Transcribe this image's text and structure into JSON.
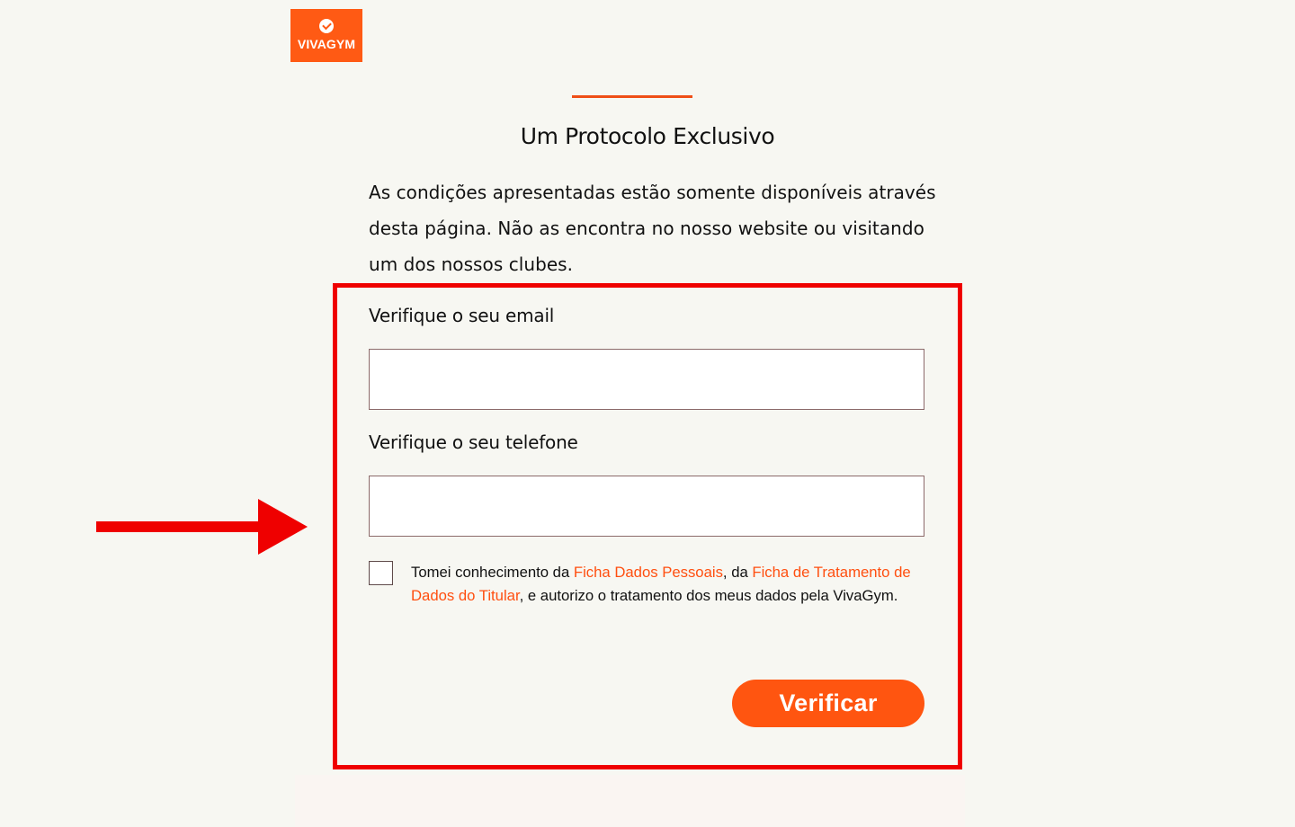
{
  "brand": {
    "name": "VIVAGYM",
    "icon": "heart-check-icon",
    "color": "#ff5a14"
  },
  "page": {
    "title": "Um Protocolo Exclusivo",
    "intro_lines": [
      "As condições apresentadas estão somente disponíveis através",
      "desta página. Não as encontra no nosso website ou visitando",
      "um dos nossos clubes."
    ]
  },
  "form": {
    "email_label": "Verifique o seu email",
    "email_value": "",
    "phone_label": "Verifique o seu telefone",
    "phone_value": "",
    "consent": {
      "checked": false,
      "prefix": "Tomei conhecimento da ",
      "link1": "Ficha Dados Pessoais",
      "middle": ", da ",
      "link2": "Ficha de Tratamento de Dados do Titular",
      "suffix": ", e autorizo o tratamento dos meus dados pela VivaGym."
    },
    "submit_label": "Verificar"
  },
  "annotations": {
    "highlight_color": "#ef0000",
    "arrow_icon": "right-arrow-icon"
  },
  "colors": {
    "background": "#f7f7f2",
    "accent": "#ef4f17",
    "link": "#ff4f10",
    "button": "#ff5510"
  }
}
